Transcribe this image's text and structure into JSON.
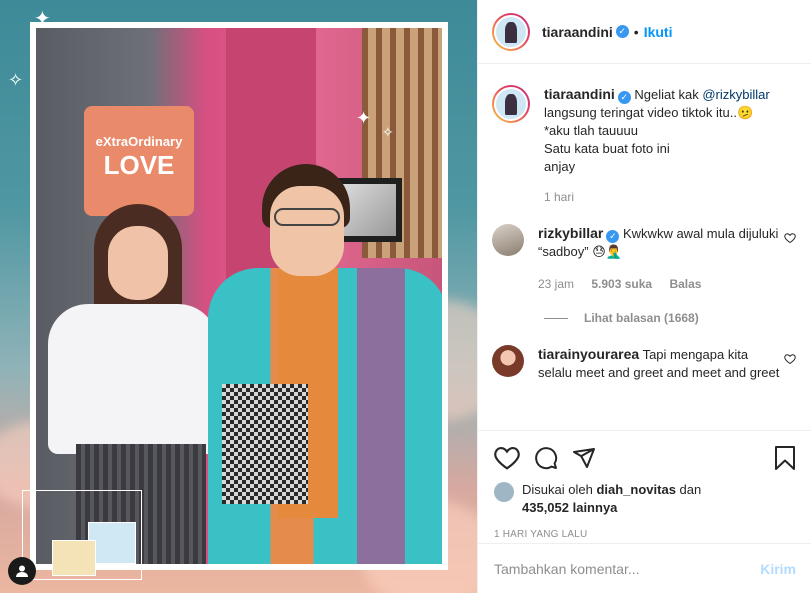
{
  "post": {
    "username": "tiaraandini",
    "follow_label": "Ikuti",
    "dot": "•",
    "verified_mark": "✓"
  },
  "caption": {
    "username": "tiaraandini",
    "text_before_mention": "Ngeliat kak ",
    "mention": "@rizkybillar",
    "text_after_mention": "\nlangsung teringat video tiktok itu..🫤\n*aku tlah tauuuu\nSatu kata buat foto ini\nanjay",
    "time": "1 hari"
  },
  "comments": [
    {
      "username": "rizkybillar",
      "verified": true,
      "text": "Kwkwkw awal mula dijuluki “sadboy” 😓🤦‍♂️",
      "time": "23 jam",
      "likes": "5.903 suka",
      "reply_label": "Balas",
      "view_replies": "Lihat balasan (1668)"
    },
    {
      "username": "tiarainyourarea",
      "verified": false,
      "text": "Tapi mengapa kita selalu meet and greet and meet and greet"
    }
  ],
  "likes": {
    "prefix": "Disukai oleh",
    "user": "diah_novitas",
    "connector": "dan",
    "count": "435,052 lainnya"
  },
  "timestamp": "1 HARI YANG LALU",
  "add_comment": {
    "placeholder": "Tambahkan komentar...",
    "post_label": "Kirim"
  },
  "photo": {
    "sign_line1": "eXtraOrdinary",
    "sign_line2": "LOVE"
  },
  "colors": {
    "accent": "#0095f6",
    "verified": "#3897f0"
  }
}
